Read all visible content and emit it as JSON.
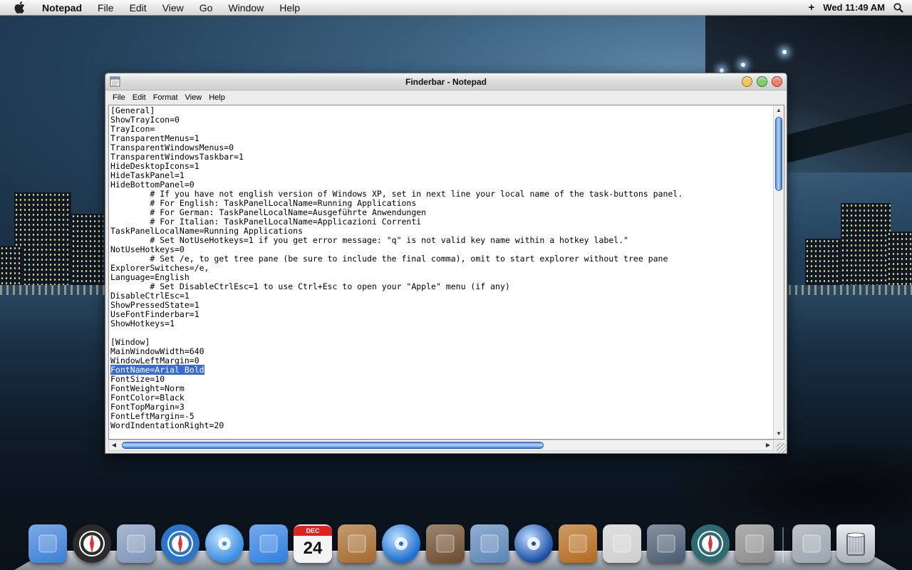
{
  "menubar": {
    "items": [
      "Notepad",
      "File",
      "Edit",
      "View",
      "Go",
      "Window",
      "Help"
    ],
    "clock": "Wed 11:49 AM",
    "plus": "+"
  },
  "window": {
    "title": "Finderbar - Notepad",
    "menu": [
      "File",
      "Edit",
      "Format",
      "View",
      "Help"
    ],
    "lines": [
      "[General]",
      "ShowTrayIcon=0",
      "TrayIcon=",
      "TransparentMenus=1",
      "TransparentWindowsMenus=0",
      "TransparentWindowsTaskbar=1",
      "HideDesktopIcons=1",
      "HideTaskPanel=1",
      "HideBottomPanel=0",
      "        # If you have not english version of Windows XP, set in next line your local name of the task-buttons panel.",
      "        # For English: TaskPanelLocalName=Running Applications",
      "        # For German: TaskPanelLocalName=Ausgeführte Anwendungen",
      "        # For Italian: TaskPanelLocalName=Applicazioni Correnti",
      "TaskPanelLocalName=Running Applications",
      "        # Set NotUseHotkeys=1 if you get error message: \"q\" is not valid key name within a hotkey label.\"",
      "NotUseHotkeys=0",
      "        # Set /e, to get tree pane (be sure to include the final comma), omit to start explorer without tree pane",
      "ExplorerSwitches=/e,",
      "Language=English",
      "        # Set DisableCtrlEsc=1 to use Ctrl+Esc to open your \"Apple\" menu (if any)",
      "DisableCtrlEsc=1",
      "ShowPressedState=1",
      "UseFontFinderbar=1",
      "ShowHotkeys=1",
      "",
      "[Window]",
      "MainWindowWidth=640",
      "WindowLeftMargin=0",
      "FontName=Arial Bold",
      "FontSize=10",
      "FontWeight=Norm",
      "FontColor=Black",
      "FontTopMargin=3",
      "FontLeftMargin=-5",
      "WordIndentationRight=20"
    ],
    "selected_line": 28
  },
  "dock": {
    "icons": [
      {
        "name": "finder-icon",
        "color": "#3b7fd6"
      },
      {
        "name": "dashboard-icon",
        "color": "#2b2b2b"
      },
      {
        "name": "mail-icon",
        "color": "#7d95b8"
      },
      {
        "name": "safari-icon",
        "color": "#2a74c9"
      },
      {
        "name": "itunes-icon",
        "color": "#3a8ee0"
      },
      {
        "name": "ichat-icon",
        "color": "#2f7fe0"
      },
      {
        "name": "ical-icon",
        "color": "#e6e6e6"
      },
      {
        "name": "address-book-icon",
        "color": "#a5692c"
      },
      {
        "name": "quicktime-icon",
        "color": "#1d6fd0"
      },
      {
        "name": "iphoto-icon",
        "color": "#6b4a2b"
      },
      {
        "name": "preview-icon",
        "color": "#5a86b8"
      },
      {
        "name": "dvd-player-icon",
        "color": "#1b4fa6"
      },
      {
        "name": "garageband-icon",
        "color": "#b36a1c"
      },
      {
        "name": "photo-booth-icon",
        "color": "#cfcfcf"
      },
      {
        "name": "spaces-icon",
        "color": "#4a5b70"
      },
      {
        "name": "time-machine-icon",
        "color": "#2d6b73"
      },
      {
        "name": "system-preferences-icon",
        "color": "#8a8a8a"
      },
      {
        "name": "stack-folder-icon",
        "color": "#9aa5b0"
      },
      {
        "name": "trash-icon",
        "color": "#c7ccd2"
      }
    ],
    "ical_month": "DEC",
    "ical_day": "24"
  }
}
